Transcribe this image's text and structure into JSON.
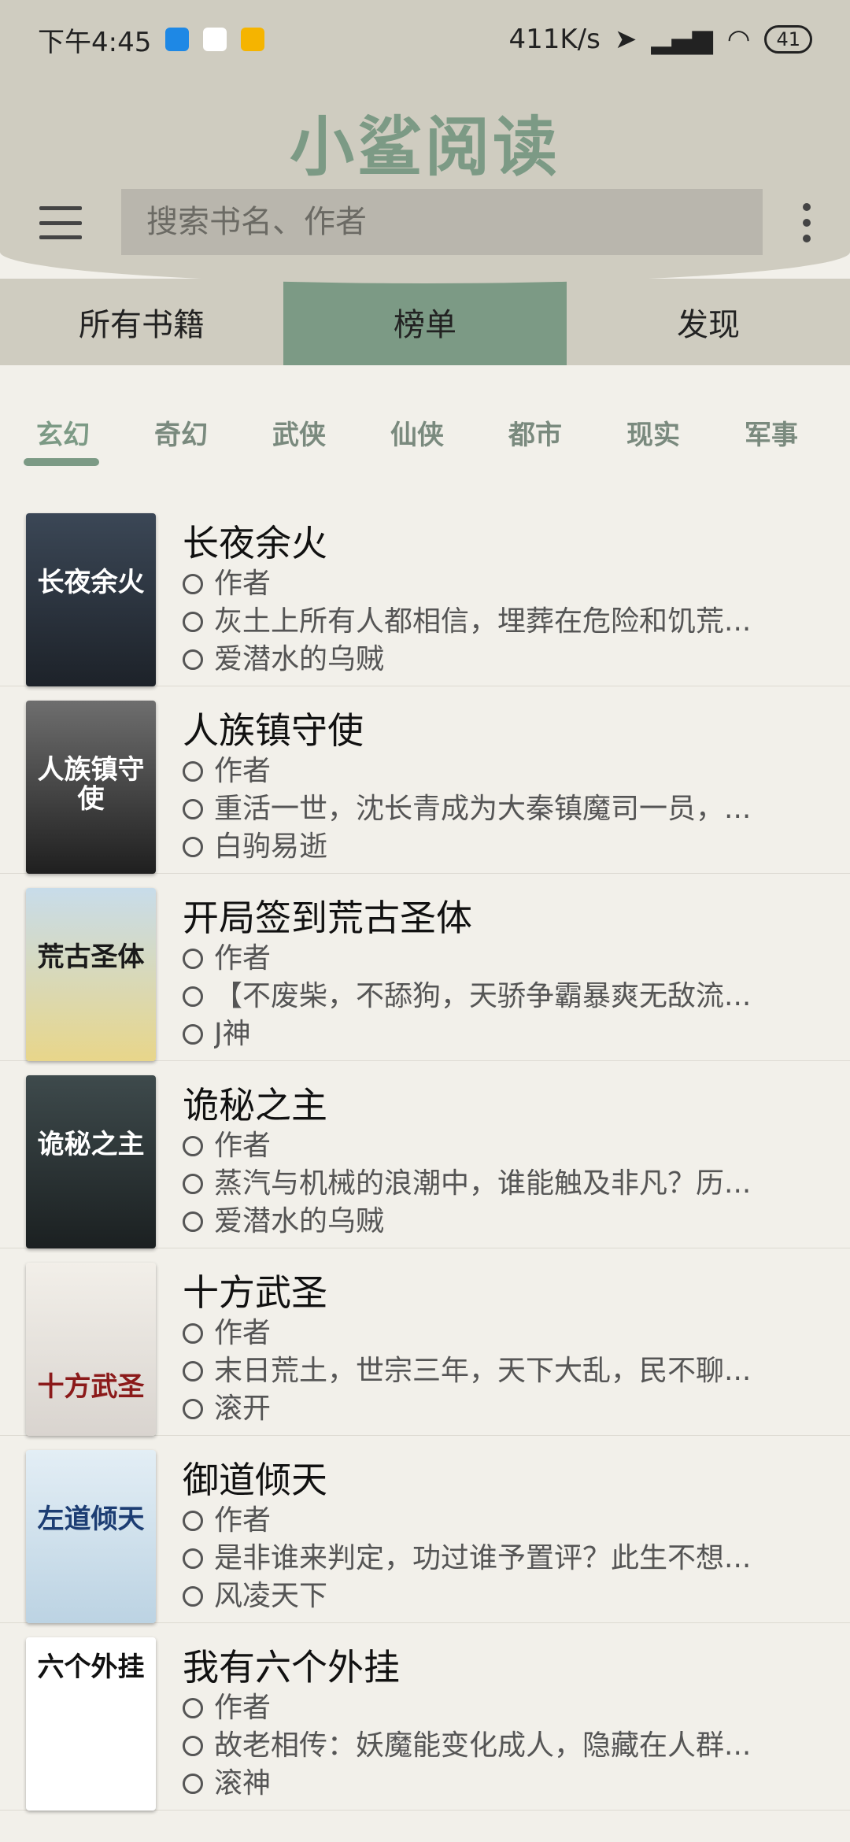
{
  "status_bar": {
    "time": "下午4:45",
    "speed": "411K/s",
    "battery": "41"
  },
  "header": {
    "title": "小鲨阅读",
    "search_placeholder": "搜索书名、作者"
  },
  "tabs": [
    {
      "label": "所有书籍"
    },
    {
      "label": "榜单"
    },
    {
      "label": "发现"
    }
  ],
  "categories": [
    "玄幻",
    "奇幻",
    "武侠",
    "仙侠",
    "都市",
    "现实",
    "军事"
  ],
  "books": [
    {
      "title": "长夜余火",
      "author_label": "作者",
      "intro": "灰土上所有人都相信，埋葬在危险和饥荒...",
      "author": "爱潜水的乌贼",
      "cover_text": "长夜余火",
      "cover_color": "#2c3440"
    },
    {
      "title": "人族镇守使",
      "author_label": "作者",
      "intro": "重活一世，沈长青成为大秦镇魔司一员，...",
      "author": "白驹易逝",
      "cover_text": "人族镇守使",
      "cover_color": "#3a3a3a"
    },
    {
      "title": "开局签到荒古圣体",
      "author_label": "作者",
      "intro": "【不废柴，不舔狗，天骄争霸暴爽无敌流...",
      "author": "J神",
      "cover_text": "荒古圣体",
      "cover_color": "#8fb1c9"
    },
    {
      "title": "诡秘之主",
      "author_label": "作者",
      "intro": "蒸汽与机械的浪潮中，谁能触及非凡？历...",
      "author": "爱潜水的乌贼",
      "cover_text": "诡秘之主",
      "cover_color": "#2b3133"
    },
    {
      "title": "十方武圣",
      "author_label": "作者",
      "intro": "末日荒土，世宗三年，天下大乱，民不聊...",
      "author": "滚开",
      "cover_text": "十方武圣",
      "cover_color": "#e8e4e0"
    },
    {
      "title": "御道倾天",
      "author_label": "作者",
      "intro": "是非谁来判定，功过谁予置评？此生不想...",
      "author": "风凌天下",
      "cover_text": "左道倾天",
      "cover_color": "#d6e6f0"
    },
    {
      "title": "我有六个外挂",
      "author_label": "作者",
      "intro": "故老相传：妖魔能变化成人，隐藏在人群...",
      "author": "滚神",
      "cover_text": "六个外挂",
      "cover_color": "#ffffff"
    }
  ]
}
